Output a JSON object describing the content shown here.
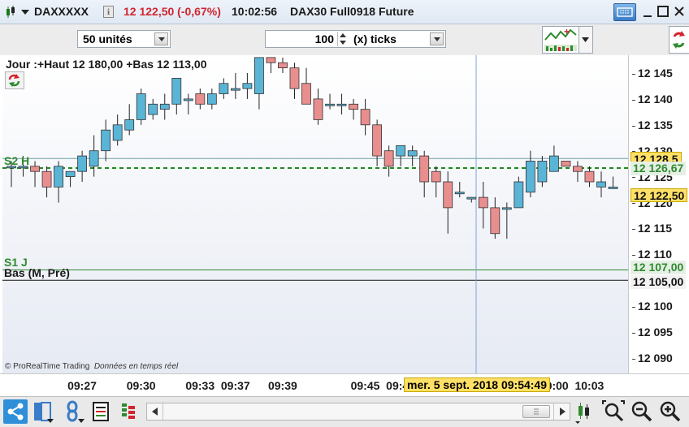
{
  "title": {
    "symbol": "DAXXXXX",
    "price": "12 122,50 (-0,67%)",
    "time": "10:02:56",
    "instrument": "DAX30 Full0918 Future"
  },
  "toolbar": {
    "units_select": "50 unités",
    "ticks_value": "100",
    "ticks_select": "(x) ticks"
  },
  "chart": {
    "info_text": "Jour :+Haut 12 180,00 +Bas 12 113,00",
    "label_s2": "S2 H",
    "label_s1": "S1 J",
    "label_bas": "Bas (M, Pré)",
    "credit_prefix": "© ProRealTime Trading",
    "credit_suffix": "Données en temps réel",
    "tag_s2": "12 128,5",
    "tag_dashed": "12 126,67",
    "tag_last": "12 122,50",
    "tag_s1": "12 107,00",
    "tag_bas": "12 105,00",
    "crosshair_label": "mer. 5 sept. 2018 09:54:49",
    "colors": {
      "up": "#5ab4d6",
      "down": "#e88e8e",
      "dashed": "#1f8a1f",
      "s_line": "#2e8b2e"
    }
  },
  "chart_data": {
    "type": "candlestick",
    "y_ticks": [
      "12 145",
      "12 140",
      "12 135",
      "12 130",
      "12 125",
      "12 120",
      "12 115",
      "12 110",
      "12 105",
      "12 100",
      "12 095",
      "12 090"
    ],
    "y_tick_values": [
      12145,
      12140,
      12135,
      12130,
      12125,
      12120,
      12115,
      12110,
      12105,
      12100,
      12095,
      12090
    ],
    "x_ticks": [
      "09:27",
      "09:30",
      "09:33",
      "09:37",
      "09:39",
      "09:45",
      "09:48",
      "10:00",
      "10:03"
    ],
    "x_tick_bar_index": [
      6,
      11,
      16,
      19,
      23,
      30,
      33,
      46,
      49
    ],
    "candles": [
      [
        12127,
        12128,
        12123,
        12127
      ],
      [
        12127,
        12129,
        12125,
        12127
      ],
      [
        12127,
        12128,
        12123,
        12126
      ],
      [
        12126,
        12127,
        12121,
        12123
      ],
      [
        12123,
        12128,
        12120,
        12127
      ],
      [
        12125,
        12126,
        12123,
        12126
      ],
      [
        12126,
        12130,
        12124,
        12129
      ],
      [
        12127,
        12133,
        12125,
        12130
      ],
      [
        12130,
        12136,
        12128,
        12134
      ],
      [
        12132,
        12137,
        12131,
        12135
      ],
      [
        12134,
        12139,
        12133,
        12136
      ],
      [
        12136,
        12142,
        12135,
        12141
      ],
      [
        12137,
        12140,
        12136,
        12139
      ],
      [
        12138,
        12141,
        12136,
        12139
      ],
      [
        12139,
        12144,
        12137,
        12144
      ],
      [
        12140,
        12141,
        12137,
        12140
      ],
      [
        12141,
        12142,
        12138,
        12139
      ],
      [
        12139,
        12142,
        12138,
        12141
      ],
      [
        12141,
        12144,
        12140,
        12143
      ],
      [
        12142,
        12145,
        12140,
        12142
      ],
      [
        12142,
        12145,
        12140,
        12143
      ],
      [
        12141,
        12146,
        12138,
        12148
      ],
      [
        12148,
        12148,
        12145,
        12147
      ],
      [
        12147,
        12148,
        12145,
        12146
      ],
      [
        12146,
        12147,
        12140,
        12142
      ],
      [
        12143,
        12146,
        12139,
        12139
      ],
      [
        12140,
        12142,
        12135,
        12136
      ],
      [
        12139,
        12141,
        12138,
        12139
      ],
      [
        12139,
        12141,
        12137,
        12139
      ],
      [
        12139,
        12140,
        12136,
        12138
      ],
      [
        12138,
        12140,
        12133,
        12135
      ],
      [
        12135,
        12136,
        12127,
        12129
      ],
      [
        12130,
        12131,
        12125,
        12127
      ],
      [
        12129,
        12131,
        12127,
        12131
      ],
      [
        12129,
        12131,
        12127,
        12130
      ],
      [
        12129,
        12130,
        12121,
        12124
      ],
      [
        12126,
        12127,
        12121,
        12124
      ],
      [
        12124,
        12126,
        12114,
        12119
      ],
      [
        12122,
        12124,
        12121,
        12122
      ],
      [
        12121,
        12121,
        12120,
        12121
      ],
      [
        12121,
        12124,
        12115,
        12119
      ],
      [
        12119,
        12121,
        12113,
        12114
      ],
      [
        12119,
        12120,
        12113,
        12119
      ],
      [
        12119,
        12125,
        12119,
        12124
      ],
      [
        12122,
        12130,
        12121,
        12128
      ],
      [
        12124,
        12129,
        12123,
        12128
      ],
      [
        12126,
        12131,
        12126,
        12129
      ],
      [
        12128,
        12128,
        12127,
        12127
      ],
      [
        12127,
        12128,
        12124,
        12126
      ],
      [
        12126,
        12127,
        12123,
        12124
      ],
      [
        12123,
        12126,
        12121,
        12124
      ],
      [
        12123,
        12125,
        12123,
        12123
      ]
    ],
    "xlabel": "",
    "ylabel": ""
  }
}
